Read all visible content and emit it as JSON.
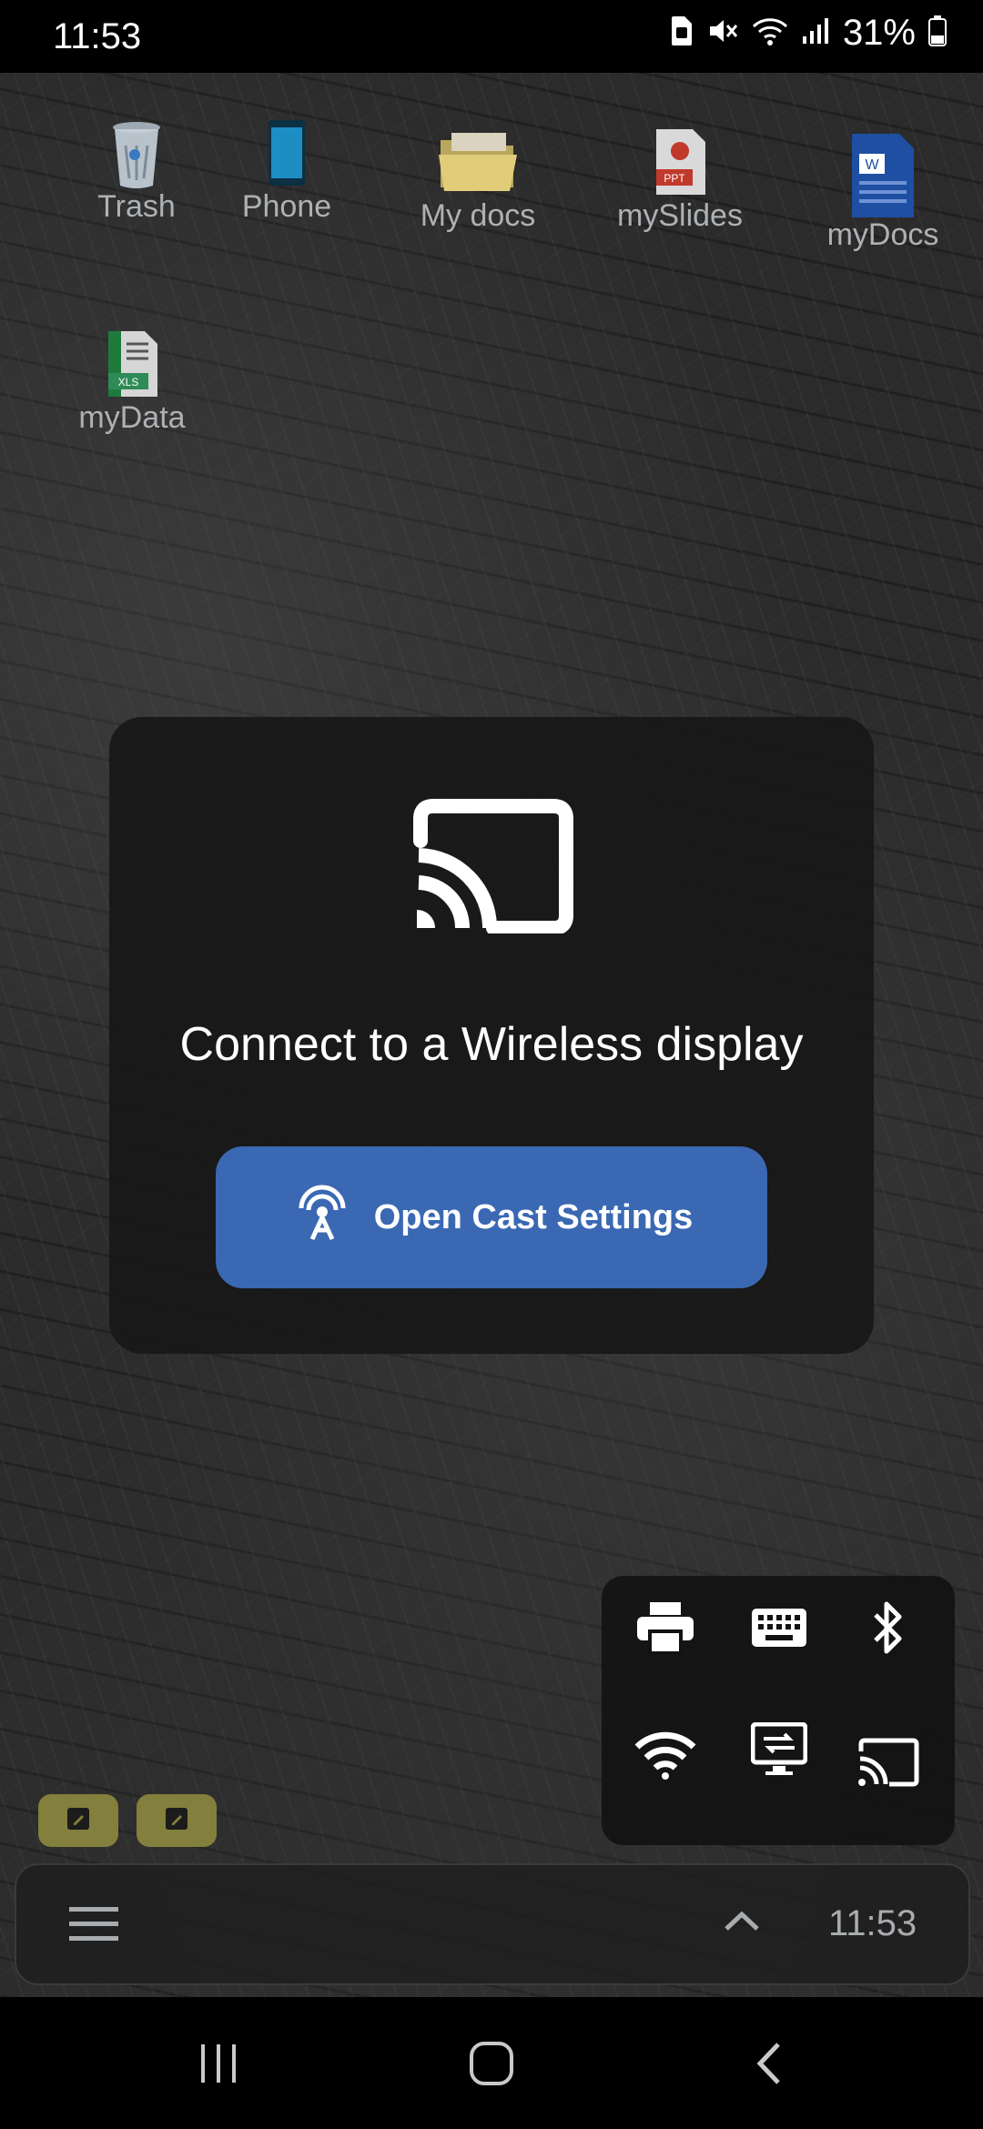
{
  "status_bar": {
    "time": "11:53",
    "battery_percent": "31%",
    "icons": [
      "sim-card-icon",
      "mute-icon",
      "wifi-icon",
      "signal-icon",
      "battery-icon"
    ]
  },
  "desktop": {
    "icons": [
      {
        "label": "Trash",
        "icon": "trash-icon"
      },
      {
        "label": "Phone",
        "icon": "phone-icon"
      },
      {
        "label": "My docs",
        "icon": "folder-icon"
      },
      {
        "label": "mySlides",
        "icon": "ppt-icon"
      },
      {
        "label": "myDocs",
        "icon": "word-doc-icon"
      },
      {
        "label": "myData",
        "icon": "xls-icon"
      }
    ]
  },
  "cast_dialog": {
    "title": "Connect to a Wireless display",
    "button_label": "Open Cast Settings",
    "accent_color": "#3a68b3"
  },
  "quick_panel": {
    "items": [
      "printer-icon",
      "keyboard-icon",
      "bluetooth-icon",
      "wifi-icon",
      "display-settings-icon",
      "cast-icon"
    ]
  },
  "sticky_notes": [
    "note-icon",
    "note-icon"
  ],
  "taskbar": {
    "time": "11:53",
    "icons": [
      "menu-icon",
      "chevron-up-icon"
    ]
  },
  "nav_bar": {
    "icons": [
      "recents-icon",
      "home-icon",
      "back-icon"
    ]
  }
}
